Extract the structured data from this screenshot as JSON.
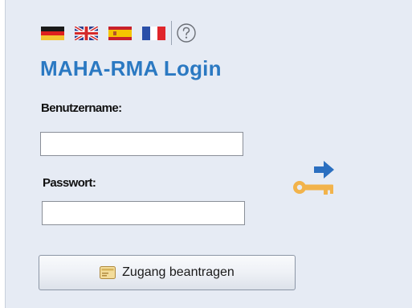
{
  "languages": [
    {
      "name": "german-flag-icon",
      "code": "de"
    },
    {
      "name": "uk-flag-icon",
      "code": "en"
    },
    {
      "name": "spanish-flag-icon",
      "code": "es"
    },
    {
      "name": "french-flag-icon",
      "code": "fr"
    }
  ],
  "help_icon": "question-mark-circle-icon",
  "login": {
    "title": "MAHA-RMA Login",
    "username_label": "Benutzername:",
    "username_value": "",
    "password_label": "Passwort:",
    "password_value": "",
    "submit_icon": "key-arrow-icon",
    "request_access_label": "Zugang beantragen",
    "request_access_icon": "card-icon"
  },
  "colors": {
    "panel_background": "#e6ebf4",
    "title": "#2b79c2",
    "key": "#f2b34b",
    "arrow": "#2b6fc0"
  }
}
